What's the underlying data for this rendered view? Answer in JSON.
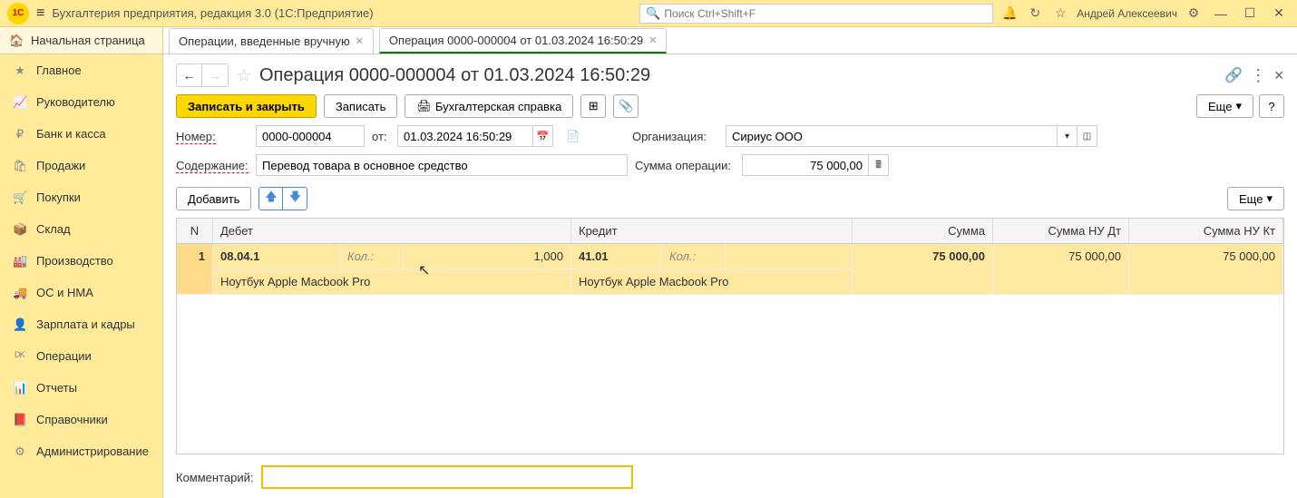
{
  "titlebar": {
    "app_title": "Бухгалтерия предприятия, редакция 3.0  (1С:Предприятие)",
    "search_placeholder": "Поиск Ctrl+Shift+F",
    "user": "Андрей Алексеевич"
  },
  "sidebar": {
    "home": "Начальная страница",
    "items": [
      {
        "icon": "★",
        "label": "Главное"
      },
      {
        "icon": "📈",
        "label": "Руководителю"
      },
      {
        "icon": "₽",
        "label": "Банк и касса"
      },
      {
        "icon": "🛍",
        "label": "Продажи"
      },
      {
        "icon": "🛒",
        "label": "Покупки"
      },
      {
        "icon": "📦",
        "label": "Склад"
      },
      {
        "icon": "🏭",
        "label": "Производство"
      },
      {
        "icon": "🚚",
        "label": "ОС и НМА"
      },
      {
        "icon": "👤",
        "label": "Зарплата и кадры"
      },
      {
        "icon": "ᴰᴷ",
        "label": "Операции"
      },
      {
        "icon": "📊",
        "label": "Отчеты"
      },
      {
        "icon": "📕",
        "label": "Справочники"
      },
      {
        "icon": "⚙",
        "label": "Администрирование"
      }
    ]
  },
  "tabs": [
    {
      "label": "Операции, введенные вручную",
      "active": false
    },
    {
      "label": "Операция 0000-000004 от 01.03.2024 16:50:29",
      "active": true
    }
  ],
  "doc": {
    "title": "Операция 0000-000004 от 01.03.2024 16:50:29",
    "save_close": "Записать и закрыть",
    "save": "Записать",
    "print": "Бухгалтерская справка",
    "more": "Еще",
    "help": "?",
    "number_label": "Номер:",
    "number": "0000-000004",
    "from_label": "от:",
    "date": "01.03.2024 16:50:29",
    "org_label": "Организация:",
    "org": "Сириус ООО",
    "content_label": "Содержание:",
    "content": "Перевод товара в основное средство",
    "sum_label": "Сумма операции:",
    "sum": "75 000,00",
    "add": "Добавить",
    "table_more": "Еще",
    "comment_label": "Комментарий:",
    "comment": ""
  },
  "table": {
    "headers": {
      "n": "N",
      "debit": "Дебет",
      "credit": "Кредит",
      "sum": "Сумма",
      "nu_dt": "Сумма НУ Дт",
      "nu_kt": "Сумма НУ Кт"
    },
    "qty_label": "Кол.:",
    "rows": [
      {
        "n": "1",
        "db_acc": "08.04.1",
        "db_qty": "1,000",
        "db_item": "Ноутбук Apple Macbook Pro",
        "kr_acc": "41.01",
        "kr_qty": "",
        "kr_item": "Ноутбук Apple Macbook Pro",
        "sum": "75 000,00",
        "nu_dt": "75 000,00",
        "nu_kt": "75 000,00"
      }
    ]
  }
}
